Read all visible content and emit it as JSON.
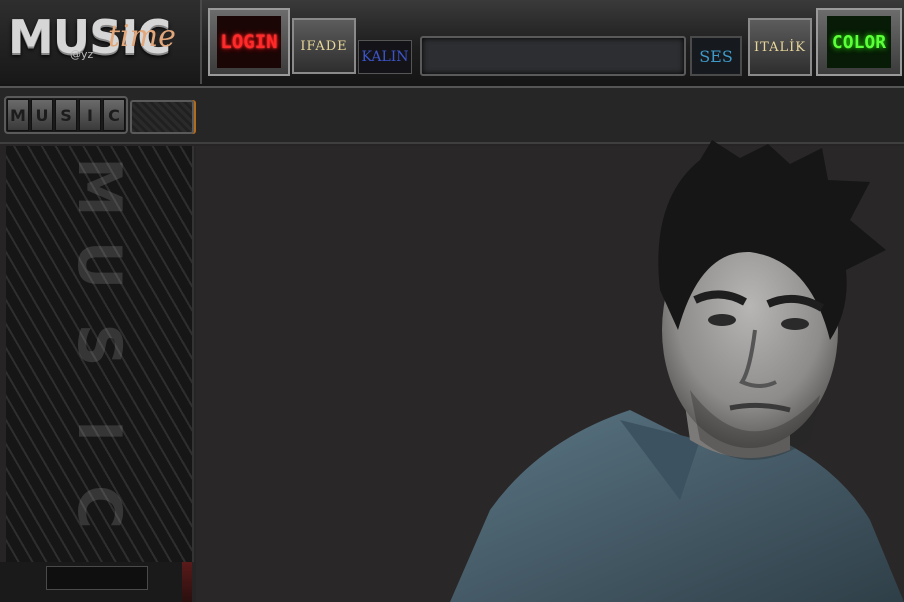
{
  "logo": {
    "word": "MUSIC",
    "script": "time",
    "tag": "@yz"
  },
  "toolbar": {
    "login_label": "LOGIN",
    "ifade_label": "IFADE",
    "kalin_label": "KALIN",
    "ses_label": "SES",
    "italik_label": "ITALİK",
    "color_label": "COLOR",
    "message_value": ""
  },
  "nav": {
    "music_letters": [
      "M",
      "U",
      "S",
      "I",
      "C"
    ]
  },
  "sidebar": {
    "letters": [
      "M",
      "U",
      "S",
      "I",
      "C"
    ]
  },
  "colors": {
    "login_glow": "#ff2a2a",
    "color_glow": "#5bff3a",
    "kalin_text": "#3d55c9",
    "ses_text": "#3e9ac8",
    "ifade_text": "#e8d79a",
    "logo_script": "#e2a77a"
  },
  "icons": {
    "portrait": "man-portrait-image"
  }
}
